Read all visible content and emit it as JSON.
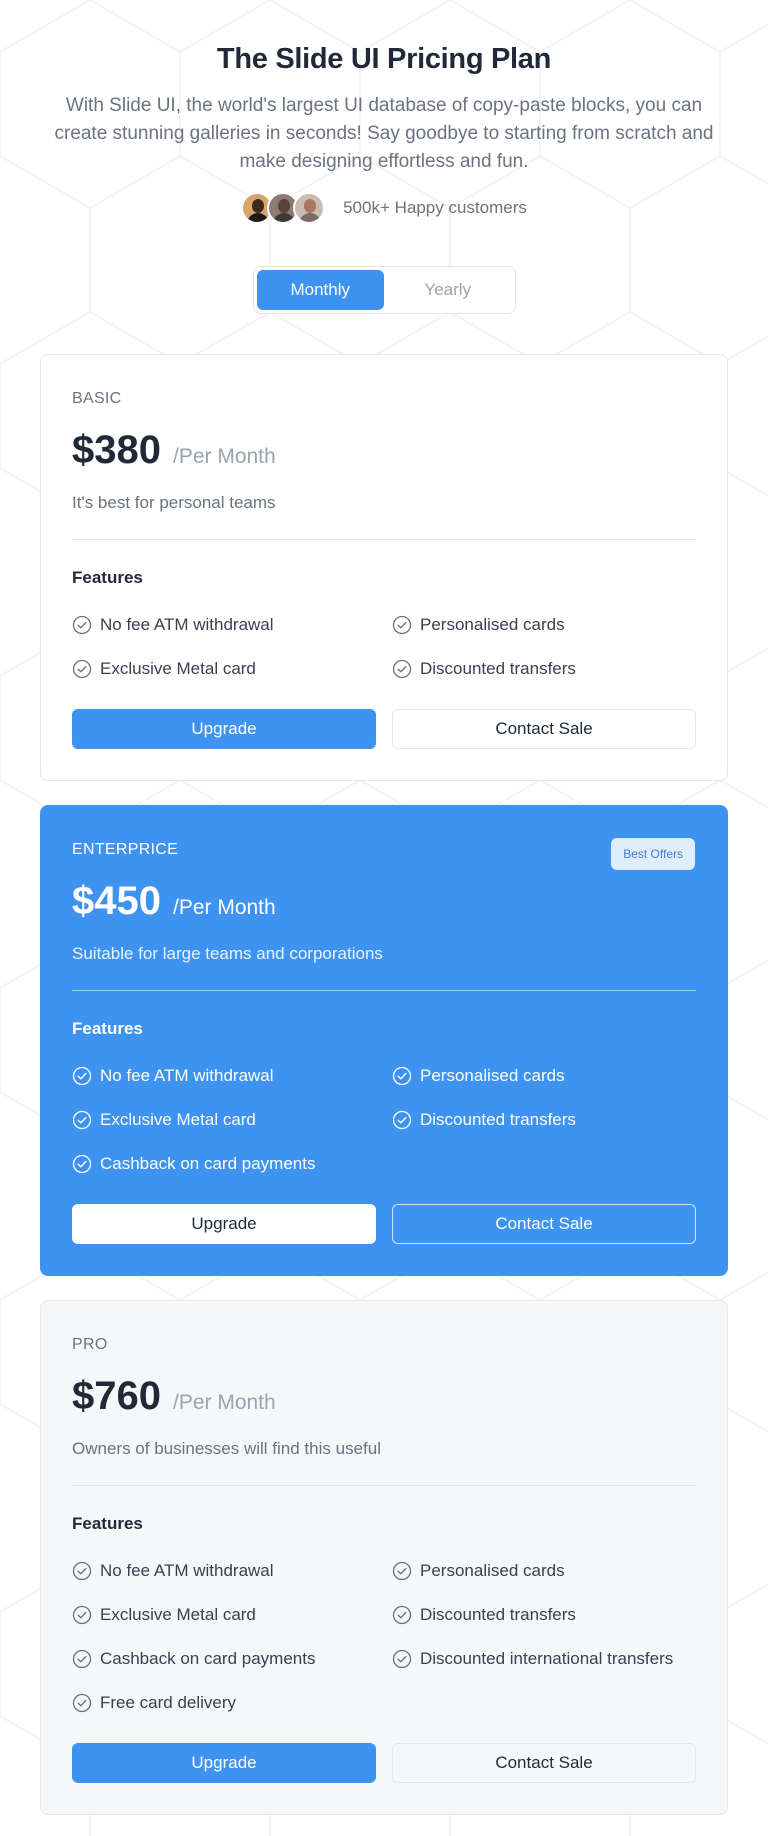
{
  "hero": {
    "title": "The Slide UI Pricing Plan",
    "subtitle": "With Slide UI, the world's largest UI database of copy-paste blocks, you can create stunning galleries in seconds! Say goodbye to starting from scratch and make designing effortless and fun.",
    "customers_text": "500k+ Happy customers"
  },
  "toggle": {
    "monthly": "Monthly",
    "yearly": "Yearly",
    "selected": "Monthly"
  },
  "colors": {
    "accent": "#3f93f0",
    "badge_bg": "#e0edfb",
    "muted_card_bg": "#f6f7f9"
  },
  "plans": [
    {
      "name": "BASIC",
      "price": "$380",
      "period": "/Per Month",
      "description": "It's best for personal teams",
      "features_title": "Features",
      "features": [
        "No fee ATM withdrawal",
        "Personalised cards",
        "Exclusive Metal card",
        "Discounted transfers"
      ],
      "upgrade_label": "Upgrade",
      "contact_label": "Contact Sale"
    },
    {
      "name": "ENTERPRICE",
      "badge": "Best Offers",
      "price": "$450",
      "period": "/Per Month",
      "description": "Suitable for large teams and corporations",
      "features_title": "Features",
      "features": [
        "No fee ATM withdrawal",
        "Personalised cards",
        "Exclusive Metal card",
        "Discounted transfers",
        "Cashback on card payments"
      ],
      "upgrade_label": "Upgrade",
      "contact_label": "Contact Sale"
    },
    {
      "name": "PRO",
      "price": "$760",
      "period": "/Per Month",
      "description": "Owners of businesses will find this useful",
      "features_title": "Features",
      "features": [
        "No fee ATM withdrawal",
        "Personalised cards",
        "Exclusive Metal card",
        "Discounted transfers",
        "Cashback on card payments",
        "Discounted international transfers",
        "Free card delivery"
      ],
      "upgrade_label": "Upgrade",
      "contact_label": "Contact Sale"
    }
  ]
}
